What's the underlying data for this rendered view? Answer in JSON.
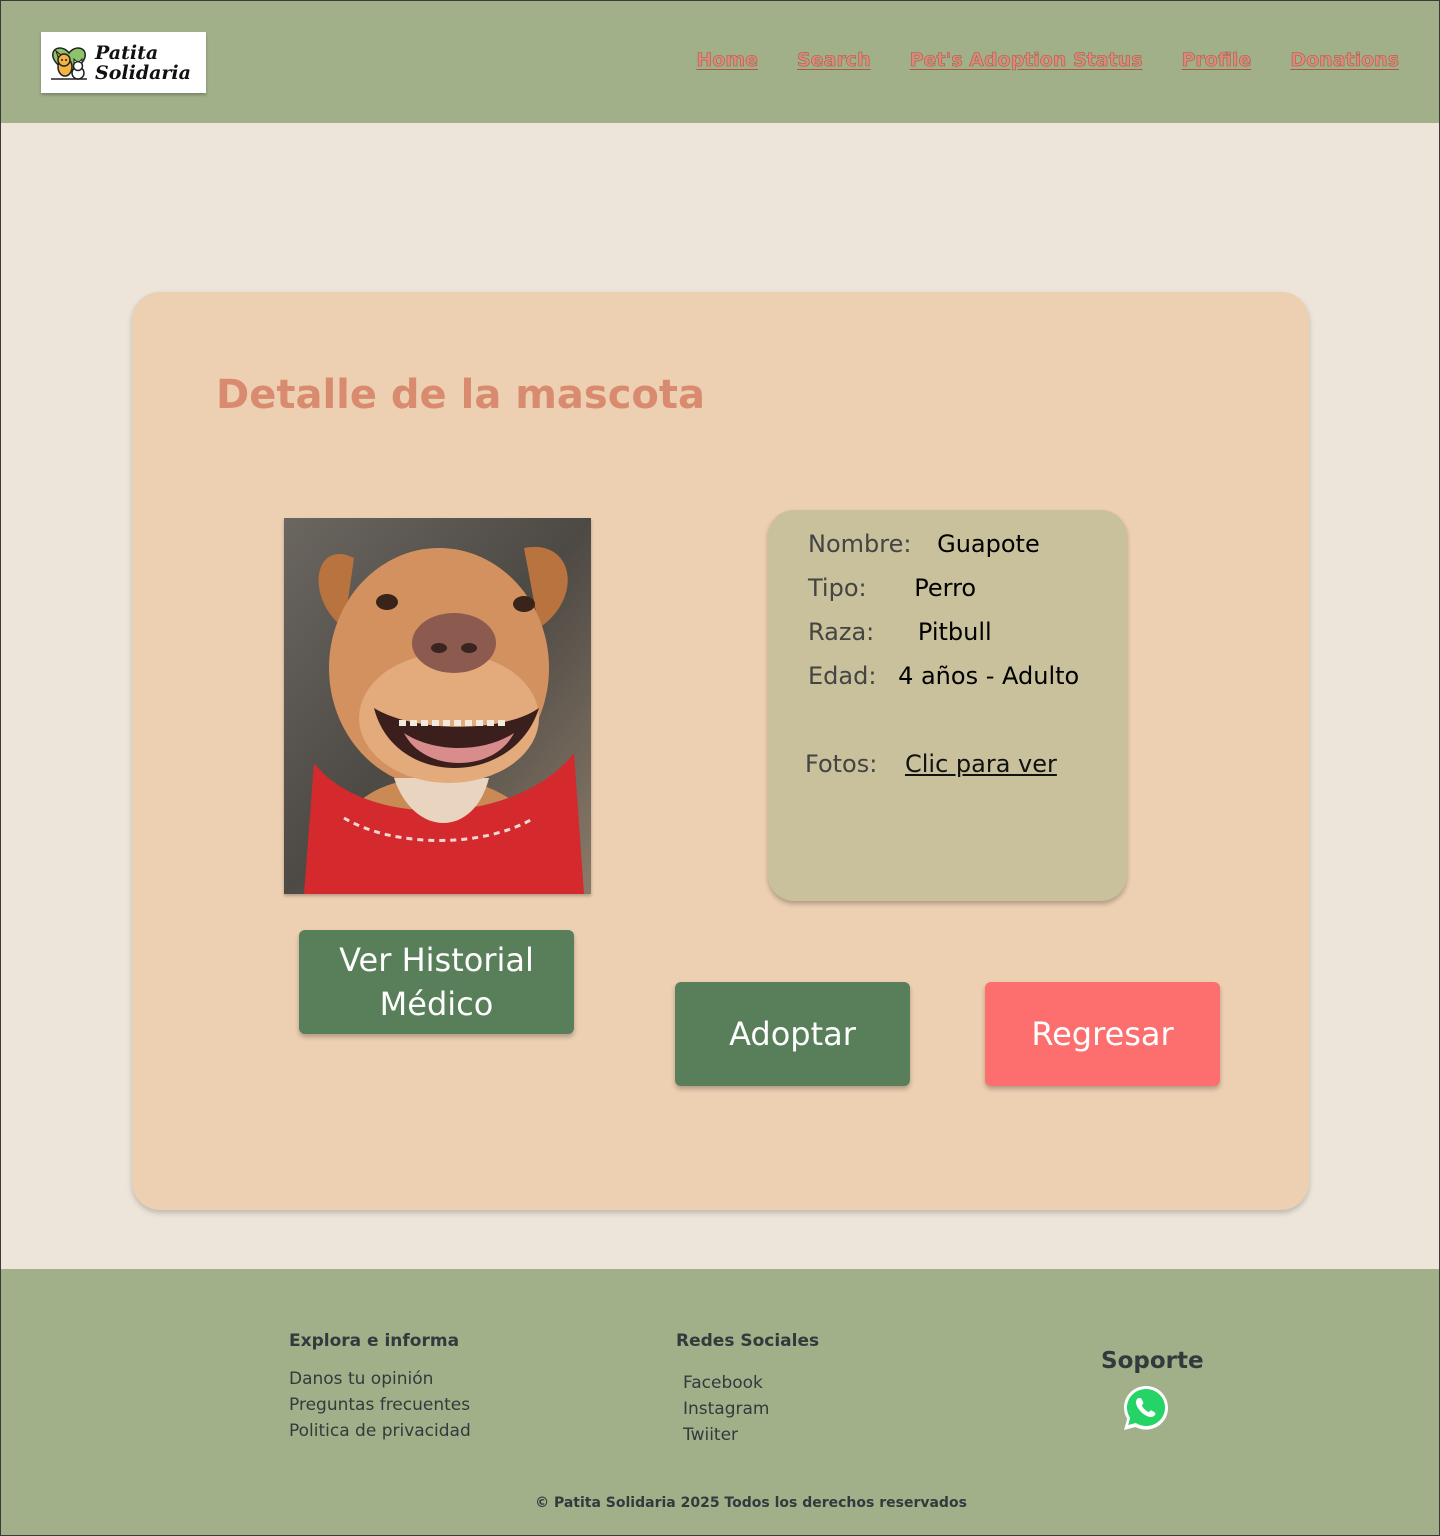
{
  "header": {
    "logo_line1": "Patita",
    "logo_line2": "Solidaria",
    "nav": [
      "Home",
      "Search",
      "Pet's Adoption Status",
      "Profile",
      "Donations"
    ]
  },
  "card": {
    "title": "Detalle de la mascota",
    "info": {
      "name_label": "Nombre:",
      "name_value": "Guapote",
      "type_label": "Tipo:",
      "type_value": "Perro",
      "breed_label": "Raza:",
      "breed_value": "Pitbull",
      "age_label": "Edad:",
      "age_value": "4 años - Adulto",
      "photos_label": "Fotos:",
      "photos_link": "Clic para ver"
    },
    "buttons": {
      "history_line1": "Ver Historial",
      "history_line2": "Médico",
      "adopt": "Adoptar",
      "back": "Regresar"
    }
  },
  "footer": {
    "explore_title": "Explora e informa",
    "explore_links": [
      "Danos tu opinión",
      "Preguntas frecuentes",
      "Politica de privacidad"
    ],
    "social_title": "Redes Sociales",
    "social_links": [
      "Facebook",
      "Instagram",
      "Twiiter"
    ],
    "support_title": "Soporte",
    "support_icon": "whatsapp-icon",
    "copyright": "© Patita Solidaria 2025 Todos los derechos reservados"
  },
  "colors": {
    "header_bg": "#a1b089",
    "page_bg": "#ede5da",
    "card_bg": "#edcfb1",
    "info_bg": "#c8c19c",
    "title": "#d98b70",
    "btn_green": "#587f59",
    "btn_red": "#fd6e6e"
  }
}
